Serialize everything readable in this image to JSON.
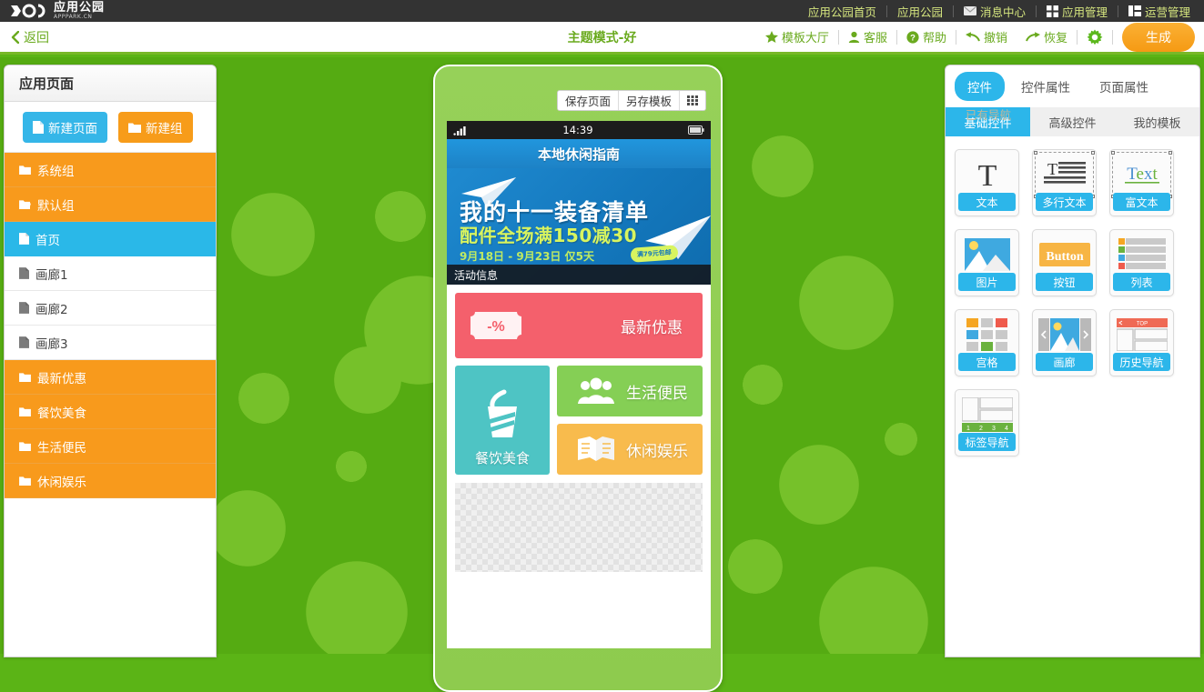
{
  "topbar": {
    "logo_cn": "应用公园",
    "logo_en": "APPPARK.CN",
    "nav": [
      {
        "label": "应用公园首页",
        "icon": ""
      },
      {
        "label": "应用公园",
        "icon": ""
      },
      {
        "label": "消息中心",
        "icon": "mail-icon"
      },
      {
        "label": "应用管理",
        "icon": "grid-icon"
      },
      {
        "label": "运营管理",
        "icon": "panel-icon"
      }
    ]
  },
  "toolbar": {
    "back_label": "返回",
    "title": "主题模式-好",
    "items": [
      {
        "label": "模板大厅",
        "icon": "star-icon"
      },
      {
        "label": "客服",
        "icon": "headset-icon"
      },
      {
        "label": "帮助",
        "icon": "question-icon"
      },
      {
        "label": "撤销",
        "icon": "undo-icon"
      },
      {
        "label": "恢复",
        "icon": "redo-icon"
      }
    ],
    "settings_icon": "gear-icon",
    "generate_label": "生成"
  },
  "sidebar": {
    "title": "应用页面",
    "new_page_label": "新建页面",
    "new_group_label": "新建组",
    "items": [
      {
        "label": "系统组",
        "type": "group",
        "icon": "folder-icon"
      },
      {
        "label": "默认组",
        "type": "group",
        "icon": "folder-open-icon"
      },
      {
        "label": "首页",
        "type": "page",
        "icon": "page-icon",
        "active": true
      },
      {
        "label": "画廊1",
        "type": "page",
        "icon": "page-icon"
      },
      {
        "label": "画廊2",
        "type": "page",
        "icon": "page-icon"
      },
      {
        "label": "画廊3",
        "type": "page",
        "icon": "page-icon"
      },
      {
        "label": "最新优惠",
        "type": "group",
        "icon": "folder-icon"
      },
      {
        "label": "餐饮美食",
        "type": "group",
        "icon": "folder-icon"
      },
      {
        "label": "生活便民",
        "type": "group",
        "icon": "folder-icon"
      },
      {
        "label": "休闲娱乐",
        "type": "group",
        "icon": "folder-icon"
      }
    ]
  },
  "phone": {
    "tools": [
      {
        "label": "保存页面"
      },
      {
        "label": "另存模板"
      },
      {
        "label": "",
        "icon": "grid-small-icon"
      }
    ],
    "status_time": "14:39",
    "signal_icon": "signal-icon",
    "battery_icon": "battery-icon",
    "app_title": "本地休闲指南",
    "banner": {
      "line1": "我的十一装备清单",
      "line2": "配件全场满150减30",
      "line3": "9月18日 - 9月23日  仅5天",
      "badge": "满79元包邮",
      "caption": "活动信息"
    },
    "tiles": [
      {
        "label": "最新优惠",
        "color": "#f4606c",
        "icon": "coupon-icon"
      },
      {
        "label": "餐饮美食",
        "color": "#4ec4c4",
        "icon": "drink-cup-icon"
      },
      {
        "label": "生活便民",
        "color": "#85cf55",
        "icon": "people-icon"
      },
      {
        "label": "休闲娱乐",
        "color": "#f8bb4d",
        "icon": "book-icon"
      }
    ]
  },
  "rightpanel": {
    "tabs": [
      {
        "label": "控件",
        "active": true
      },
      {
        "label": "控件属性",
        "active": false
      },
      {
        "label": "页面属性",
        "active": false
      }
    ],
    "subtabs": [
      {
        "label": "基础控件",
        "active": true
      },
      {
        "label": "高级控件",
        "active": false
      },
      {
        "label": "我的模板",
        "active": false
      }
    ],
    "tooltip": "已有导航",
    "widgets": [
      {
        "label": "文本",
        "icon": "text-T-icon"
      },
      {
        "label": "多行文本",
        "icon": "multiline-text-icon"
      },
      {
        "label": "富文本",
        "icon": "rich-text-icon"
      },
      {
        "label": "图片",
        "icon": "image-icon"
      },
      {
        "label": "按钮",
        "icon": "button-icon",
        "sample": "Button"
      },
      {
        "label": "列表",
        "icon": "list-icon"
      },
      {
        "label": "宫格",
        "icon": "grid-tiles-icon"
      },
      {
        "label": "画廊",
        "icon": "gallery-icon"
      },
      {
        "label": "历史导航",
        "icon": "history-nav-icon",
        "sample": "TOP"
      },
      {
        "label": "标签导航",
        "icon": "tab-nav-icon",
        "sample": "1 2 3 4"
      }
    ]
  },
  "colors": {
    "brand_green": "#6aaa1e",
    "accent_blue": "#2cb6ea",
    "accent_orange": "#f89a1c",
    "stage_green": "#55ab12"
  }
}
